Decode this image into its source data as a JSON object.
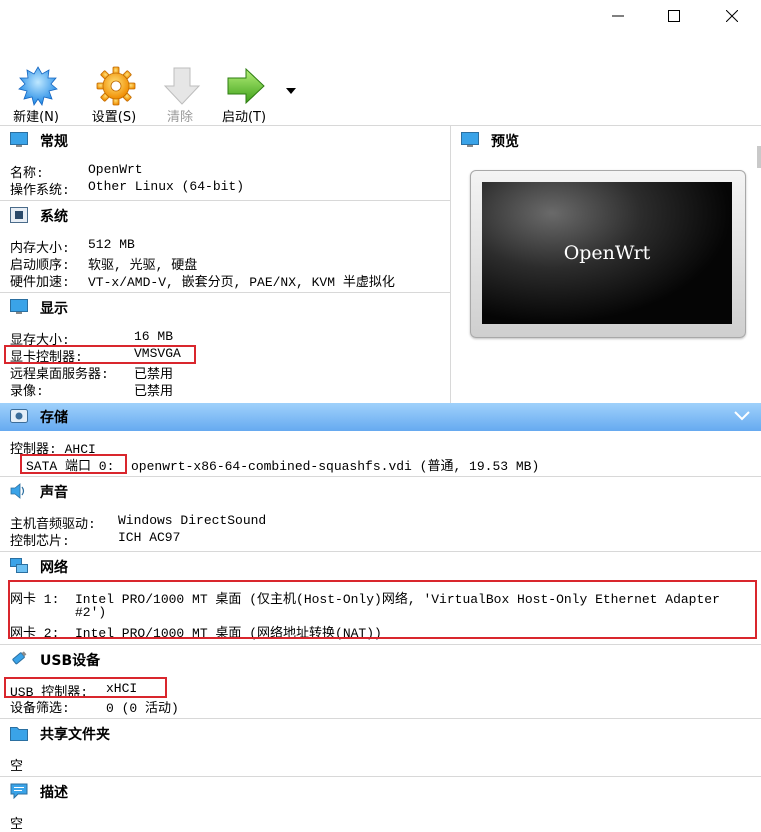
{
  "toolbar": {
    "new_label": "新建(N)",
    "settings_label": "设置(S)",
    "discard_label": "清除",
    "start_label": "启动(T)"
  },
  "general": {
    "title": "常规",
    "name_label": "名称:",
    "name_value": "OpenWrt",
    "os_label": "操作系统:",
    "os_value": "Other Linux (64-bit)"
  },
  "system": {
    "title": "系统",
    "memory_label": "内存大小:",
    "memory_value": "512 MB",
    "boot_label": "启动顺序:",
    "boot_value": "软驱, 光驱, 硬盘",
    "accel_label": "硬件加速:",
    "accel_value": "VT-x/AMD-V, 嵌套分页, PAE/NX, KVM 半虚拟化"
  },
  "display": {
    "title": "显示",
    "vram_label": "显存大小:",
    "vram_value": "16 MB",
    "controller_label": "显卡控制器:",
    "controller_value": "VMSVGA",
    "rdp_label": "远程桌面服务器:",
    "rdp_value": "已禁用",
    "record_label": "录像:",
    "record_value": "已禁用"
  },
  "preview": {
    "title": "预览",
    "screen_text": "OpenWrt"
  },
  "storage": {
    "title": "存储",
    "controller_line": "控制器: AHCI",
    "port_label": "SATA 端口 0:",
    "port_value": "openwrt-x86-64-combined-squashfs.vdi (普通, 19.53 MB)"
  },
  "audio": {
    "title": "声音",
    "driver_label": "主机音频驱动:",
    "driver_value": "Windows DirectSound",
    "chip_label": "控制芯片:",
    "chip_value": "ICH AC97"
  },
  "network": {
    "title": "网络",
    "nic1_label": "网卡 1:",
    "nic1_value": "Intel PRO/1000 MT 桌面 (仅主机(Host-Only)网络, 'VirtualBox Host-Only Ethernet Adapter",
    "nic1_cont": "#2')",
    "nic2_label": "网卡 2:",
    "nic2_value": "Intel PRO/1000 MT 桌面 (网络地址转换(NAT))"
  },
  "usb": {
    "title": "USB设备",
    "controller_label": "USB 控制器:",
    "controller_value": "xHCI",
    "filters_label": "设备筛选:",
    "filters_value": "0 (0 活动)"
  },
  "shared": {
    "title": "共享文件夹",
    "value": "空"
  },
  "description": {
    "title": "描述",
    "value": "空"
  },
  "colors": {
    "highlight_border": "#d9262d",
    "storage_bar": "#66aaf0"
  },
  "icons": [
    "minimize-icon",
    "maximize-icon",
    "close-icon",
    "new-icon",
    "settings-icon",
    "discard-icon",
    "start-icon",
    "dropdown-arrow-icon",
    "monitor-icon",
    "chip-icon",
    "display-icon",
    "preview-icon",
    "storage-icon",
    "audio-icon",
    "network-icon",
    "usb-icon",
    "folder-icon",
    "description-icon",
    "collapse-chevron-icon"
  ]
}
